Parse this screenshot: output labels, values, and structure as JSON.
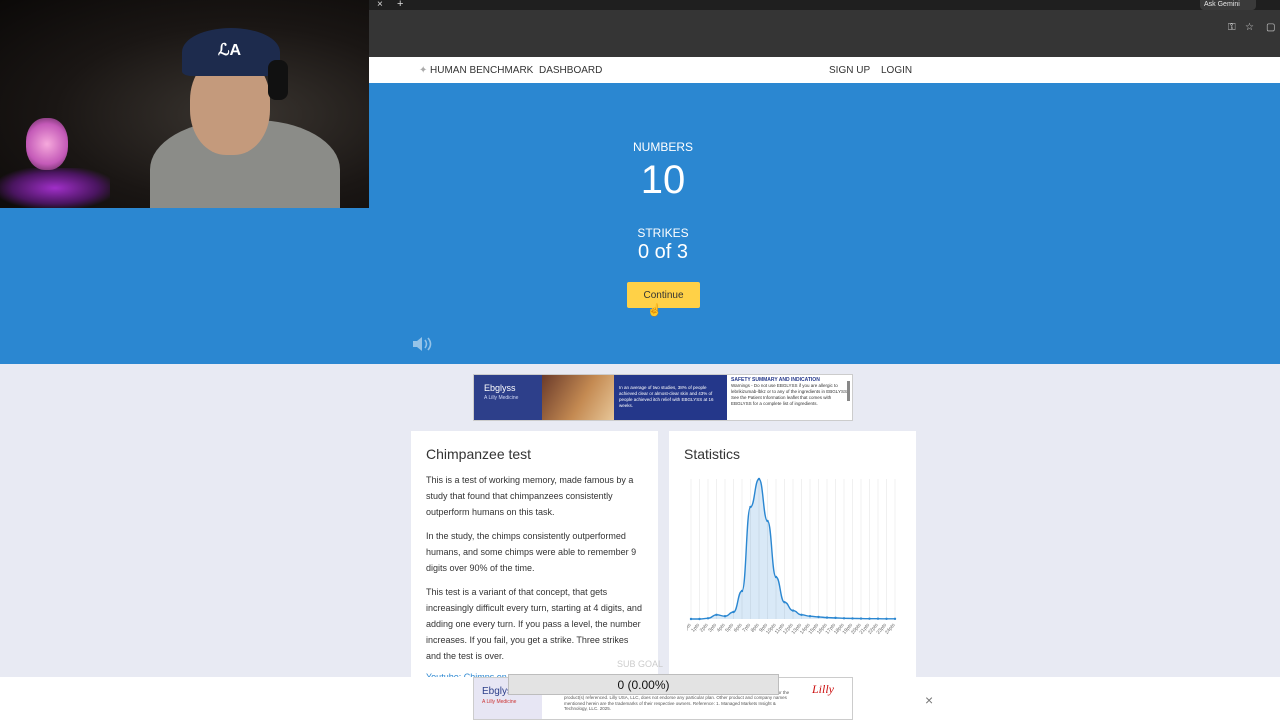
{
  "browser": {
    "tab_close": "×",
    "new_tab": "+",
    "ask_gemini": "Ask Gemini"
  },
  "header": {
    "brand": "HUMAN BENCHMARK",
    "dashboard": "DASHBOARD",
    "signup": "SIGN UP",
    "login": "LOGIN"
  },
  "test": {
    "numbers_label": "NUMBERS",
    "number_value": "10",
    "strikes_label": "STRIKES",
    "strikes_value": "0 of 3",
    "continue": "Continue"
  },
  "ad_top": {
    "brand": "Ebglyss",
    "brand_sub": "A Lilly Medicine",
    "body": "In an average of two studies, 38% of people achieved clear or almost-clear skin and 43% of people achieved itch relief with EBGLYSS at 16 weeks.",
    "safety_title": "SAFETY SUMMARY AND INDICATION",
    "safety_body": "Warnings - Do not use EBGLYSS if you are allergic to lebrikizumab-lbkz or to any of the ingredients in EBGLYSS. See the Patient Information leaflet that comes with EBGLYSS for a complete list of ingredients."
  },
  "chimp_card": {
    "title": "Chimpanzee test",
    "p1": "This is a test of working memory, made famous by a study that found that chimpanzees consistently outperform humans on this task.",
    "p2": "In the study, the chimps consistently outperformed humans, and some chimps were able to remember 9 digits over 90% of the time.",
    "p3": "This test is a variant of that concept, that gets increasingly difficult every turn, starting at 4 digits, and adding one every turn. If you pass a level, the number increases. If you fail, you get a strike. Three strikes and the test is over.",
    "link": "Youtube: Chimps on..."
  },
  "stats_card": {
    "title": "Statistics"
  },
  "chart_data": {
    "type": "area",
    "x": [
      "0pts",
      "1pts",
      "2pts",
      "3pts",
      "4pts",
      "5pts",
      "6pts",
      "7pts",
      "8pts",
      "9pts",
      "10pts",
      "11pts",
      "12pts",
      "13pts",
      "14pts",
      "15pts",
      "16pts",
      "17pts",
      "18pts",
      "19pts",
      "20pts",
      "21pts",
      "22pts",
      "23pts",
      "24pts"
    ],
    "values": [
      0,
      0,
      0.5,
      3,
      2,
      5,
      20,
      80,
      100,
      70,
      30,
      12,
      6,
      3,
      2,
      1.5,
      1,
      0.8,
      0.5,
      0.4,
      0.3,
      0.2,
      0.2,
      0.1,
      0.1
    ],
    "color": "#2b87d1",
    "grid": true,
    "title": "",
    "xlabel": "",
    "ylabel": ""
  },
  "bottom_ad": {
    "brand": "Ebglyss",
    "brand_sub": "A Lilly Medicine",
    "body": "Individual patient's coverage or payment (partial or full). Actual benefits are determined in accordance with Medicaid's policy and plan. Third-party plan names listed do not imply their endorsement of Lilly USA, LLC, or the product(s) referenced. Lilly USA, LLC, does not endorse any particular plan. Other product and company names mentioned herein are the trademarks of their respective owners. Reference: 1. Managed Markets Insight & Technology, LLC. 2025.",
    "lilly": "Lilly",
    "close": "×"
  },
  "overlay": {
    "progress": "0 (0.00%)",
    "faded": "SUB GOAL"
  },
  "colors": {
    "hero_blue": "#2b87d1",
    "continue_yellow": "#ffd147",
    "page_bg": "#e8eaf3"
  }
}
